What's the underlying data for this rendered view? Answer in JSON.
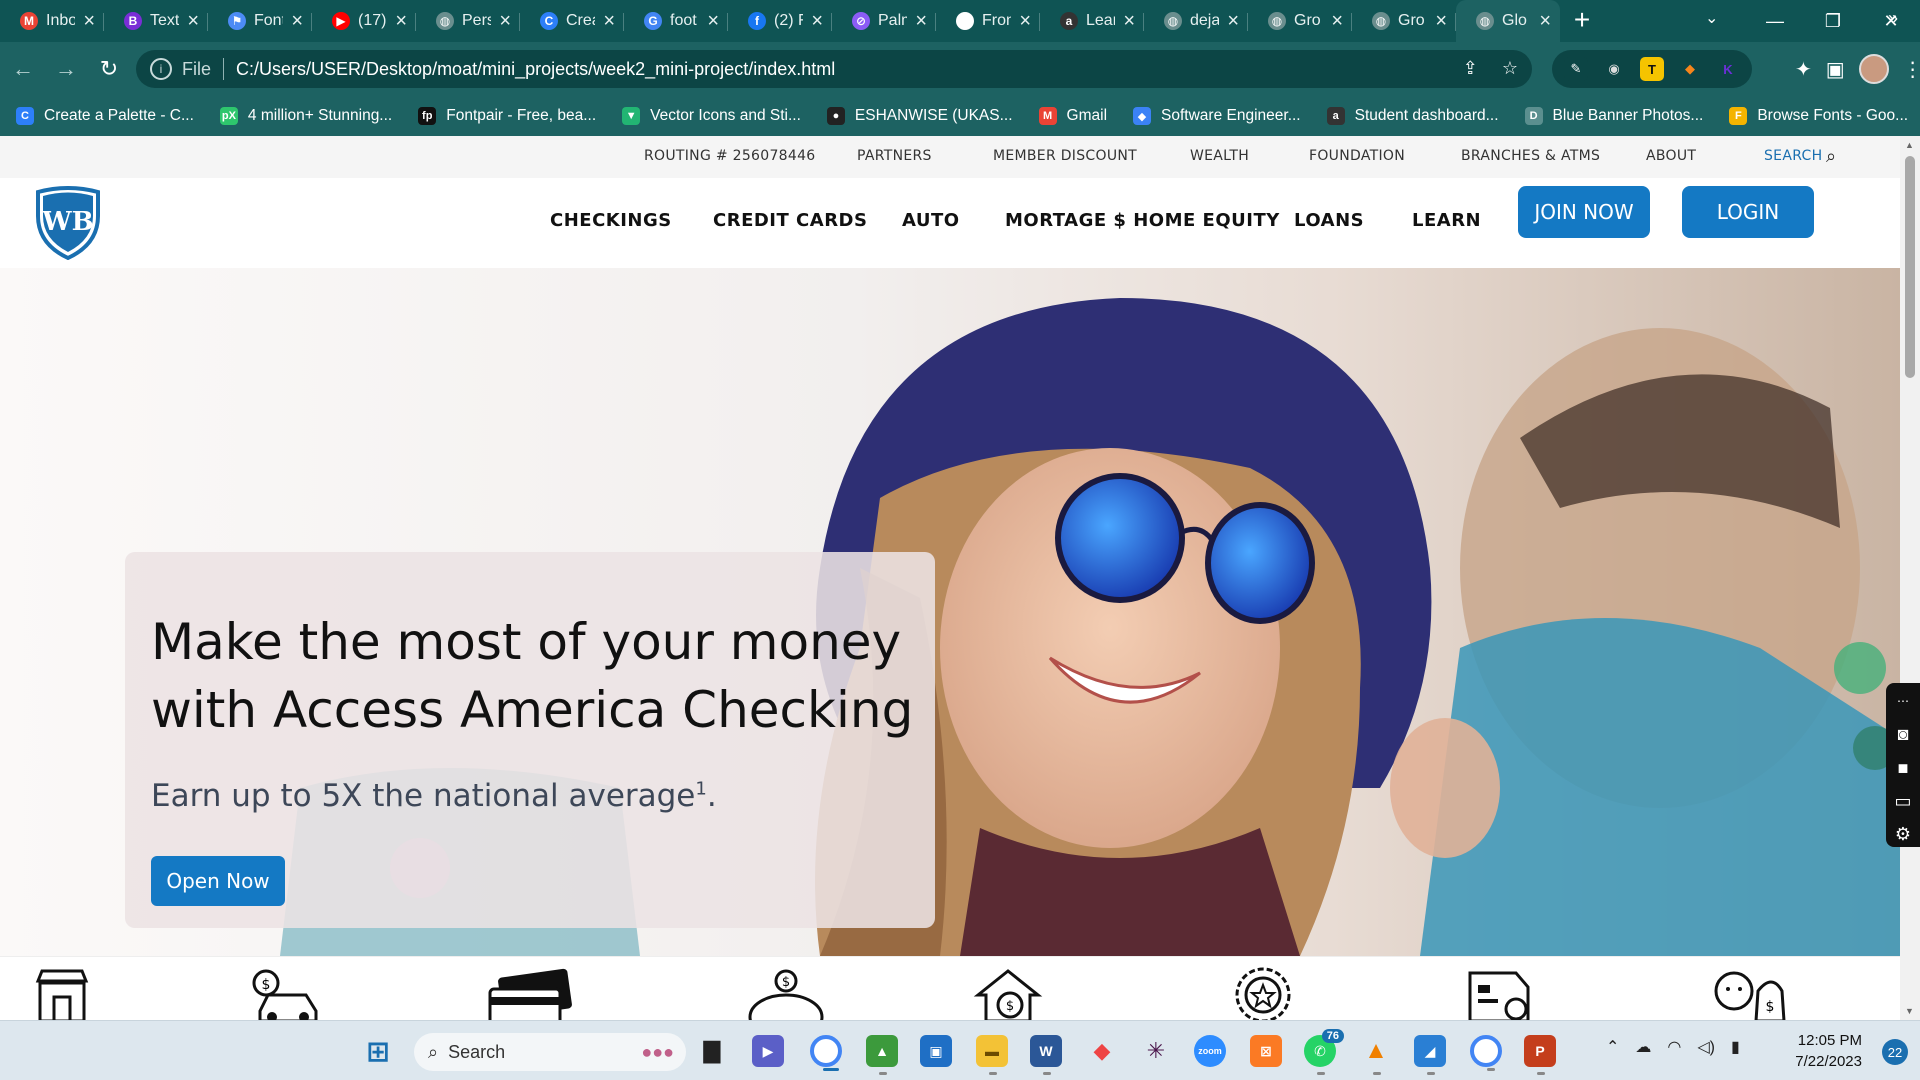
{
  "browser": {
    "tabs": [
      {
        "title": "Inbox",
        "favicon": "gmail-icon",
        "color": "#ea4335",
        "glyph": "M"
      },
      {
        "title": "Text",
        "favicon": "bootstrap-icon",
        "color": "#7a2ed6",
        "glyph": "B"
      },
      {
        "title": "Fonts",
        "favicon": "flag-icon",
        "color": "#4c8bf5",
        "glyph": "⚑"
      },
      {
        "title": "(17)",
        "favicon": "youtube-icon",
        "color": "#ff0000",
        "glyph": "▶"
      },
      {
        "title": "Pers",
        "favicon": "globe-icon",
        "color": "#6a8e8e",
        "glyph": "◍"
      },
      {
        "title": "Crea",
        "favicon": "coolors-icon",
        "color": "#2d7ff9",
        "glyph": "C"
      },
      {
        "title": "foot",
        "favicon": "google-icon",
        "color": "#4285f4",
        "glyph": "G"
      },
      {
        "title": "(2) F",
        "favicon": "facebook-icon",
        "color": "#1877f2",
        "glyph": "f"
      },
      {
        "title": "Palm",
        "favicon": "palm-icon",
        "color": "#8b5cf6",
        "glyph": "⊘"
      },
      {
        "title": "Fron",
        "favicon": "doc-icon",
        "color": "#ffffff",
        "glyph": "✎"
      },
      {
        "title": "Lear",
        "favicon": "alx-icon",
        "color": "#333333",
        "glyph": "a"
      },
      {
        "title": "deja",
        "favicon": "globe-icon",
        "color": "#6a8e8e",
        "glyph": "◍"
      },
      {
        "title": "Gro",
        "favicon": "globe-icon",
        "color": "#6a8e8e",
        "glyph": "◍"
      },
      {
        "title": "Gro",
        "favicon": "globe-icon",
        "color": "#6a8e8e",
        "glyph": "◍"
      },
      {
        "title": "Glo",
        "favicon": "globe-icon",
        "color": "#6a8e8e",
        "glyph": "◍",
        "active": true
      }
    ],
    "new_tab": "+",
    "address": {
      "scheme_label": "File",
      "url": "C:/Users/USER/Desktop/moat/mini_projects/week2_mini-project/index.html"
    },
    "bookmarks": [
      {
        "label": "Create a Palette - C...",
        "icon": "coolors-icon",
        "color": "#2d7ff9",
        "glyph": "C"
      },
      {
        "label": "4 million+ Stunning...",
        "icon": "pixabay-icon",
        "color": "#2ec66d",
        "glyph": "pX"
      },
      {
        "label": "Fontpair - Free, bea...",
        "icon": "fontpair-icon",
        "color": "#111111",
        "glyph": "fp"
      },
      {
        "label": "Vector Icons and Sti...",
        "icon": "flaticon-icon",
        "color": "#22b573",
        "glyph": "▼"
      },
      {
        "label": "ESHANWISE (UKAS...",
        "icon": "github-icon",
        "color": "#222222",
        "glyph": "●"
      },
      {
        "label": "Gmail",
        "icon": "gmail-icon",
        "color": "#ea4335",
        "glyph": "M"
      },
      {
        "label": "Software Engineer...",
        "icon": "software-icon",
        "color": "#3b82f6",
        "glyph": "◆"
      },
      {
        "label": "Student dashboard...",
        "icon": "alx-icon",
        "color": "#333333",
        "glyph": "a"
      },
      {
        "label": "Blue Banner Photos...",
        "icon": "doc-icon",
        "color": "#5b8f8f",
        "glyph": "D"
      },
      {
        "label": "Browse Fonts - Goo...",
        "icon": "google-fonts-icon",
        "color": "#f4b400",
        "glyph": "F"
      }
    ],
    "bookmarks_overflow": "»"
  },
  "site": {
    "topbar": {
      "routing": "ROUTING # 256078446",
      "partners": "PARTNERS",
      "member_discount": "MEMBER DISCOUNT",
      "wealth": "WEALTH",
      "foundation": "FOUNDATION",
      "branches": "BRANCHES & ATMS",
      "about": "ABOUT",
      "search": "SEARCH"
    },
    "logo_text": "WB",
    "nav": {
      "checkings": "CHECKINGS",
      "credit_cards": "CREDIT CARDS",
      "auto": "AUTO",
      "mortgage": "MORTAGE $ HOME EQUITY",
      "loans": "LOANS",
      "learn": "LEARN",
      "join": "JOIN NOW",
      "login": "LOGIN"
    },
    "hero": {
      "headline": "Make the most of your money with Access America Checking",
      "subtext": "Earn up to 5X the national average",
      "footnote": "1",
      "subtext_end": ".",
      "cta": "Open Now"
    },
    "feature_icons": [
      "store-icon",
      "car-loan-icon",
      "credit-card-icon",
      "piggy-bank-icon",
      "home-equity-icon",
      "award-icon",
      "delivery-truck-icon",
      "advisor-icon"
    ],
    "accent": "#1479c4"
  },
  "taskbar": {
    "search_label": "Search",
    "whatsapp_badge": "76",
    "clock_time": "12:05 PM",
    "clock_date": "7/22/2023",
    "notifications": "22"
  }
}
